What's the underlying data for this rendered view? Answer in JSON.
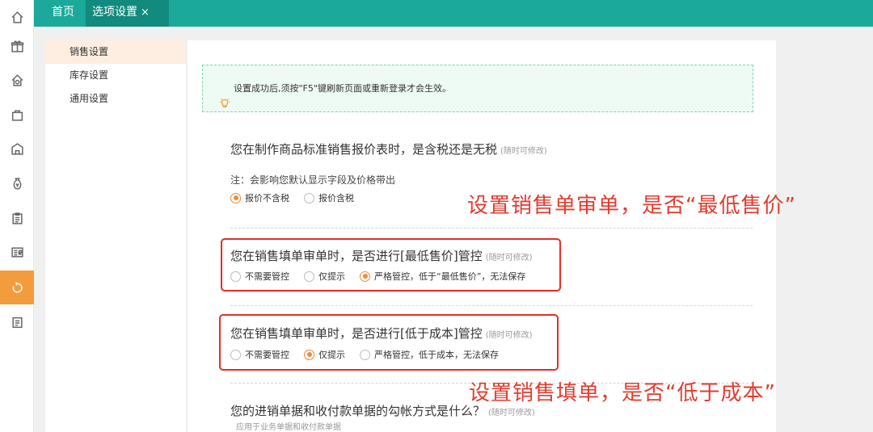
{
  "rail": {
    "icons": [
      "home-icon",
      "gift-icon",
      "house-gear-icon",
      "bag-icon",
      "warehouse-icon",
      "money-bag-icon",
      "clipboard-icon",
      "id-card-icon",
      "recycle-icon",
      "report-icon"
    ],
    "active_index": 8
  },
  "tabs": [
    {
      "label": "首页"
    },
    {
      "label": "选项设置",
      "close": "×"
    }
  ],
  "menu": {
    "items": [
      "销售设置",
      "库存设置",
      "通用设置"
    ],
    "active_index": 0
  },
  "notice": "设置成功后,须按\"F5\"键刷新页面或重新登录才会生效。",
  "sections": [
    {
      "question": "您在制作商品标准销售报价表时，是含税还是无税",
      "hint": "(随时可修改)",
      "note": "注：会影响您默认显示字段及价格带出",
      "options": [
        "报价不含税",
        "报价含税"
      ],
      "selected": 0
    },
    {
      "question": "您在销售填单审单时，是否进行[最低售价]管控",
      "hint": "(随时可修改)",
      "options": [
        "不需要管控",
        "仅提示",
        "严格管控，低于“最低售价”，无法保存"
      ],
      "selected": 2
    },
    {
      "question": "您在销售填单审单时，是否进行[低于成本]管控",
      "hint": "(随时可修改)",
      "options": [
        "不需要管控",
        "仅提示",
        "严格管控，低于成本，无法保存"
      ],
      "selected": 1
    },
    {
      "question": "您的进销单据和收付款单据的勾帐方式是什么？",
      "hint": "(随时可修改)",
      "sub": "应用于业务单据和收付款单据"
    }
  ],
  "annotations": {
    "first": "设置销售单审单，是否“最低售价”",
    "second": "设置销售填单，是否“低于成本”"
  },
  "colors": {
    "topbar": "#1aa99a",
    "active_tab": "#128a7d",
    "rail_active": "#f39c3d",
    "radio_on": "#f08a3a",
    "annotation_red": "#e12f2a",
    "notice_bg": "#eefaf4"
  }
}
